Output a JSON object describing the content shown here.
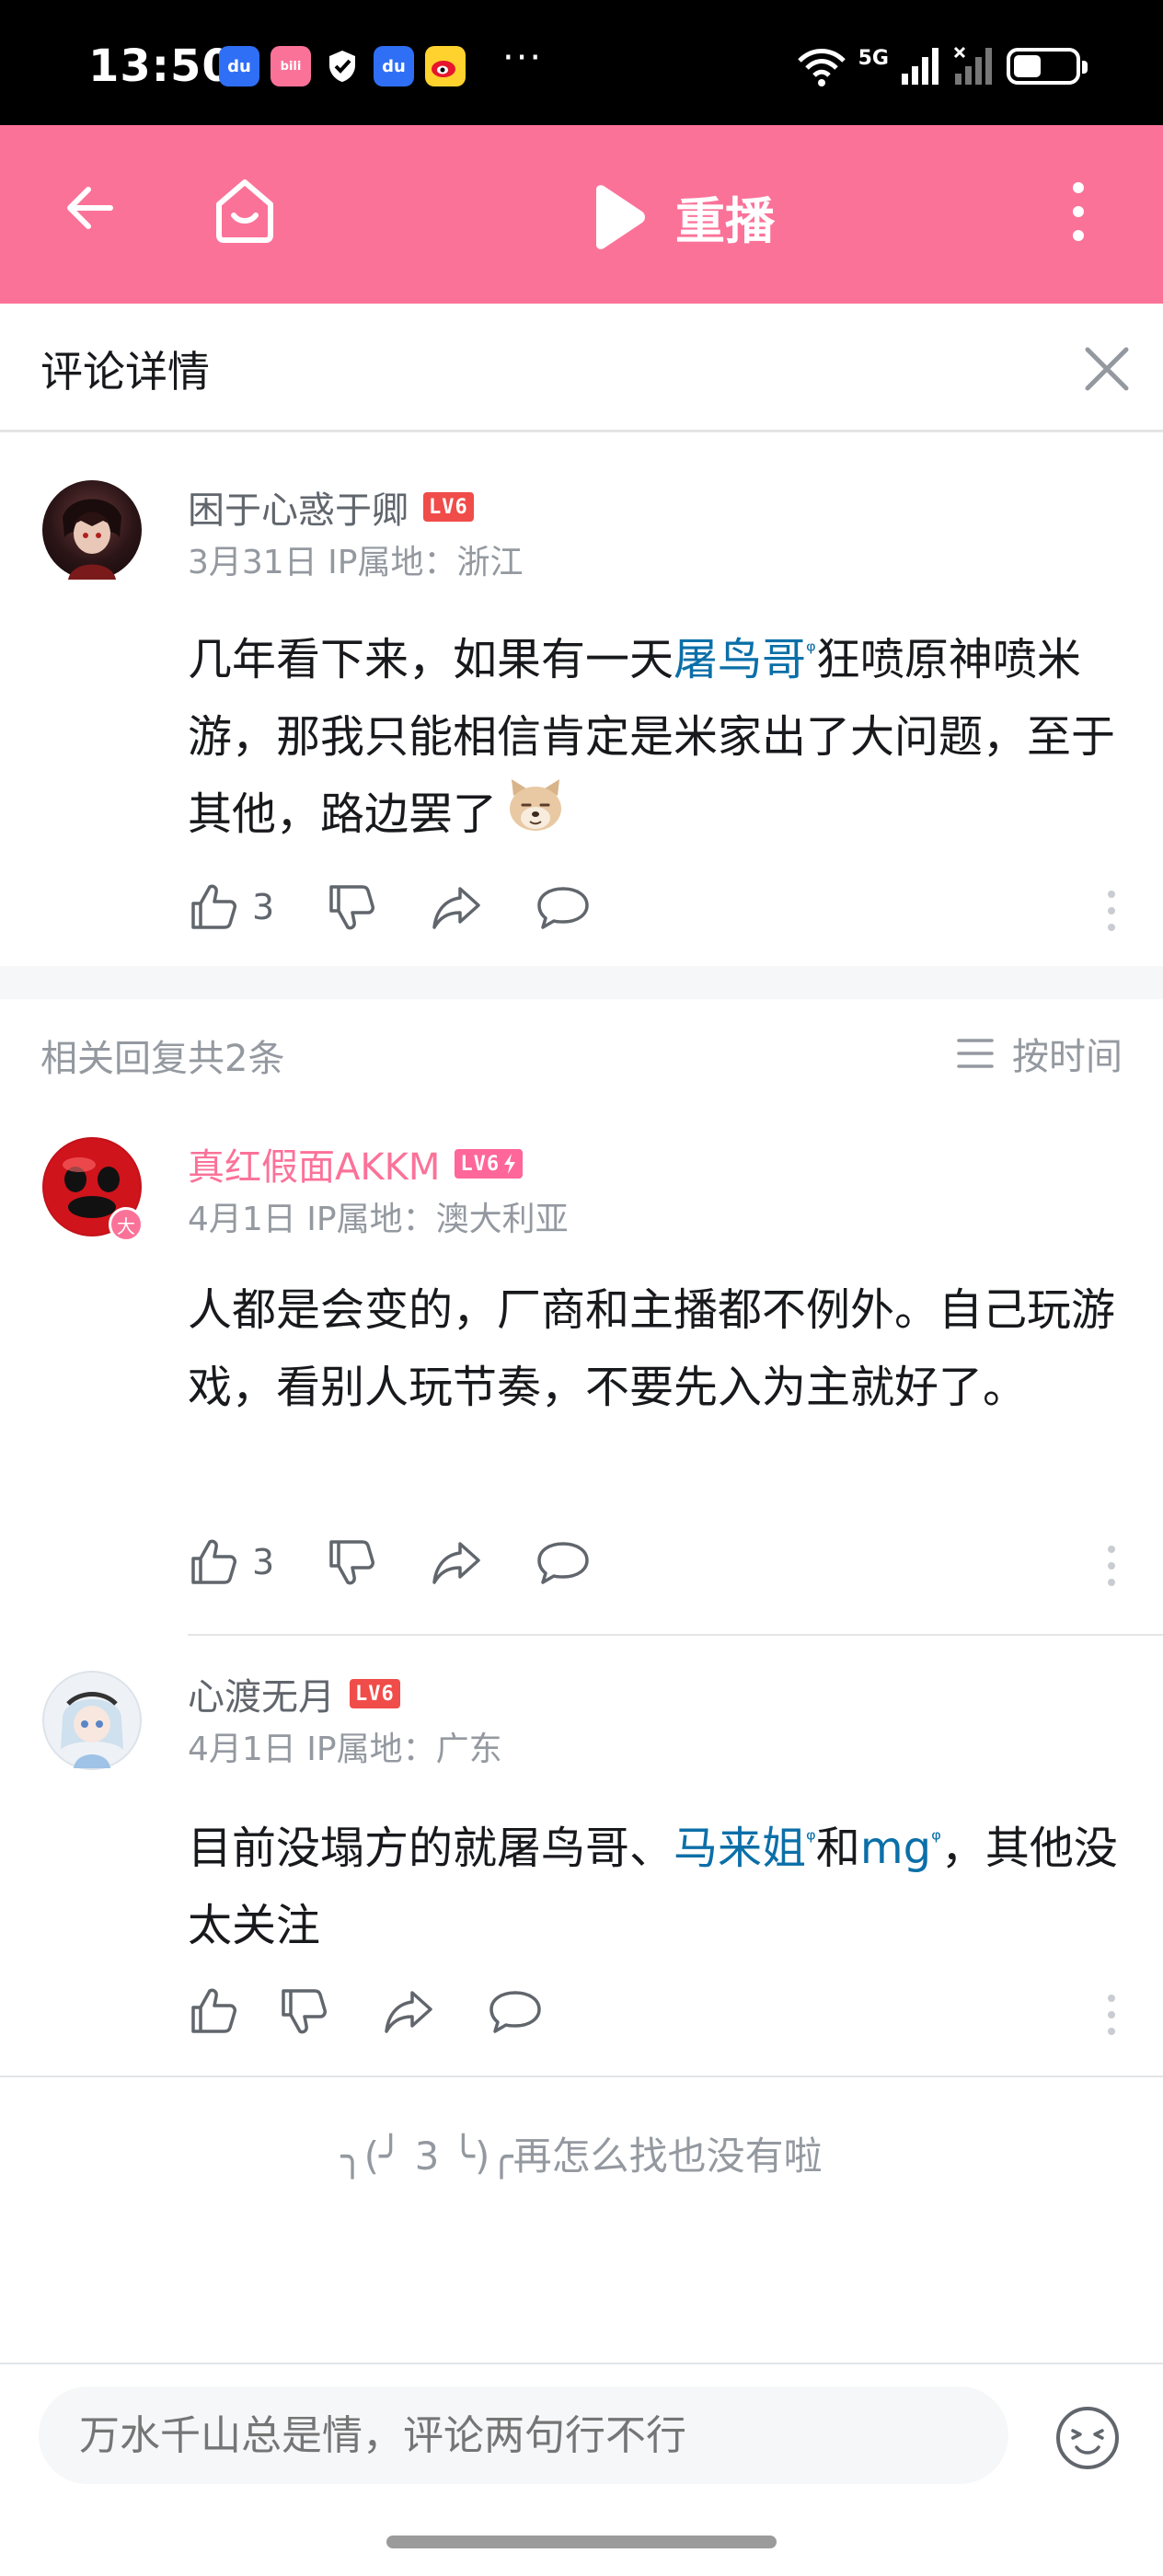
{
  "status_bar": {
    "time": "13:50",
    "notification_icons": [
      "baidu-icon",
      "bilibili-icon",
      "shield-icon",
      "baidu-icon",
      "weibo-icon"
    ],
    "more": "···",
    "network": "5G",
    "battery_level": 0.45
  },
  "header": {
    "replay_label": "重播"
  },
  "panel": {
    "title": "评论详情"
  },
  "main_comment": {
    "username": "困于心惑于卿",
    "level": "LV6",
    "meta": "3月31日 IP属地：浙江",
    "text_parts": [
      "几年看下来，如果有一天",
      "屠鸟哥",
      "狂喷原神喷米游，那我只能相信肯定是米家出了大问题，至于其他，路边罢了"
    ],
    "likes": "3"
  },
  "replies_header": {
    "count_label": "相关回复共2条",
    "sort_label": "按时间"
  },
  "replies": [
    {
      "username": "真红假面AKKM",
      "level": "LV6",
      "avatar_badge": "大",
      "meta": "4月1日 IP属地：澳大利亚",
      "text": "人都是会变的，厂商和主播都不例外。自己玩游戏，看别人玩节奏，不要先入为主就好了。",
      "likes": "3"
    },
    {
      "username": "心渡无月",
      "level": "LV6",
      "meta": "4月1日 IP属地：广东",
      "text_parts": [
        "目前没塌方的就屠鸟哥、",
        "马来姐",
        "和",
        "mg",
        "，其他没太关注"
      ]
    }
  ],
  "end_note": "╮(╯ 3 ╰)╭再怎么找也没有啦",
  "input": {
    "placeholder": "万水千山总是情，评论两句行不行"
  },
  "colors": {
    "brand_pink": "#fb7299",
    "link_blue": "#0b6fa8",
    "level_red": "#f04c49"
  }
}
